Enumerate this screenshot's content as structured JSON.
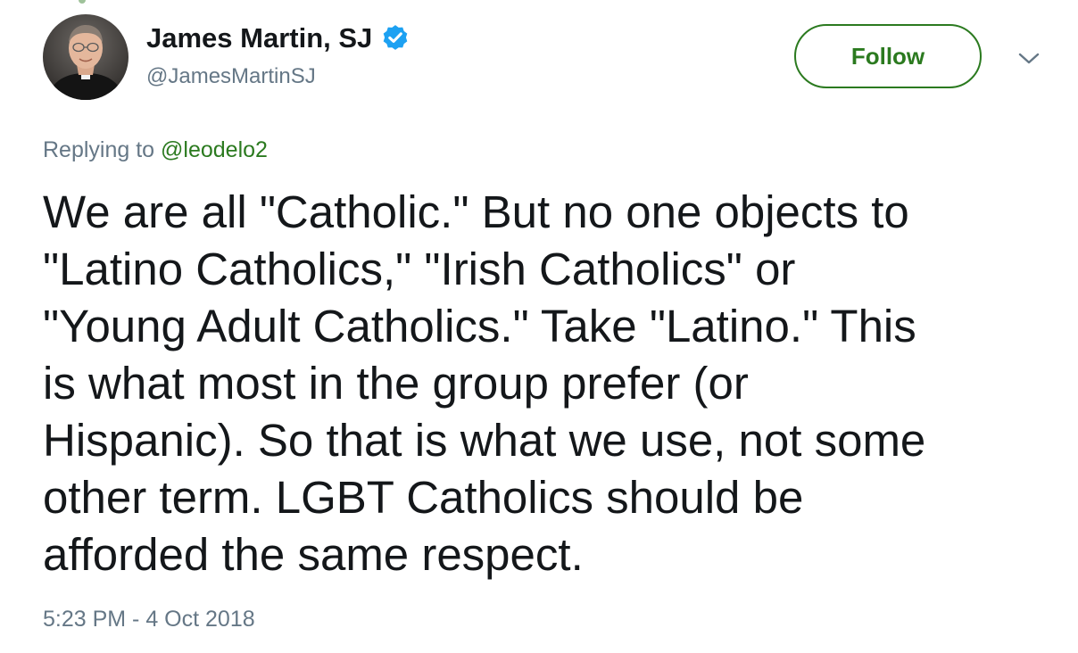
{
  "tweet": {
    "author": {
      "display_name": "James Martin, SJ",
      "handle": "@JamesMartinSJ",
      "verified_icon": "verified-badge-icon",
      "avatar_icon": "profile-photo"
    },
    "follow_label": "Follow",
    "menu_icon": "chevron-down-icon",
    "replying": {
      "prefix": "Replying to ",
      "mention": "@leodelo2"
    },
    "text_lines": [
      "We are all \"Catholic.\" But no one objects to",
      "\"Latino Catholics,\" \"Irish Catholics\" or",
      "\"Young Adult Catholics.\" Take \"Latino.\" This",
      "is what most in the group prefer (or",
      "Hispanic). So that is what we use, not some",
      "other term. LGBT Catholics should be",
      "afforded the same respect."
    ],
    "timestamp": "5:23 PM - 4 Oct 2018"
  },
  "colors": {
    "accent_green": "#2b7a1f",
    "verified_blue": "#1da1f2",
    "secondary_text": "#657786",
    "primary_text": "#14171a"
  }
}
